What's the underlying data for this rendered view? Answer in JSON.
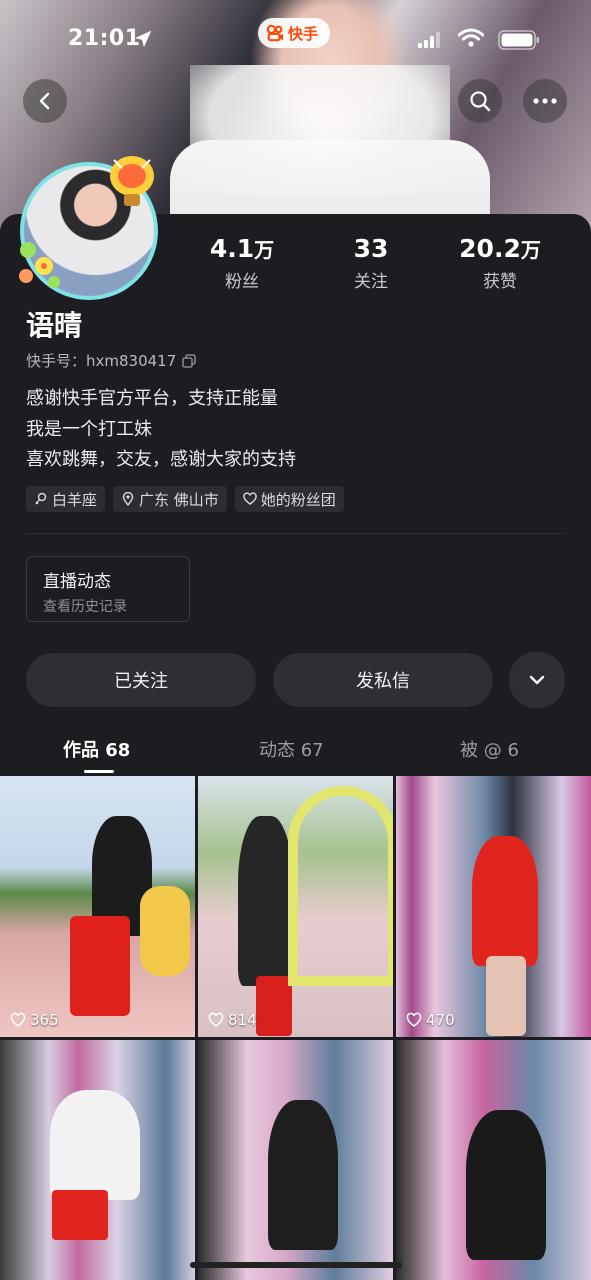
{
  "status_bar": {
    "time": "21:01"
  },
  "app_badge": {
    "label": "快手"
  },
  "profile": {
    "name": "语晴",
    "kuaishou_id_label": "快手号：",
    "kuaishou_id": "hxm830417",
    "bio": [
      "感谢快手官方平台，支持正能量",
      "我是一个打工妹",
      "喜欢跳舞，交友，感谢大家的支持"
    ],
    "tags": [
      "白羊座",
      "广东 佛山市",
      "她的粉丝团"
    ]
  },
  "stats": [
    {
      "value": "4.1",
      "unit": "万",
      "label": "粉丝"
    },
    {
      "value": "33",
      "unit": "",
      "label": "关注"
    },
    {
      "value": "20.2",
      "unit": "万",
      "label": "获赞"
    }
  ],
  "live_card": {
    "title": "直播动态",
    "subtitle": "查看历史记录"
  },
  "buttons": {
    "followed": "已关注",
    "message": "发私信"
  },
  "tabs": [
    {
      "label": "作品 68",
      "active": true
    },
    {
      "label": "动态 67",
      "active": false
    },
    {
      "label": "被 @ 6",
      "active": false
    }
  ],
  "videos": [
    {
      "likes": "365"
    },
    {
      "likes": "814"
    },
    {
      "likes": "470"
    },
    {
      "likes": ""
    },
    {
      "likes": ""
    },
    {
      "likes": ""
    }
  ],
  "colors": {
    "accent": "#ff4906",
    "background": "#1c1c21",
    "avatar_ring": "#7fe3e6"
  }
}
